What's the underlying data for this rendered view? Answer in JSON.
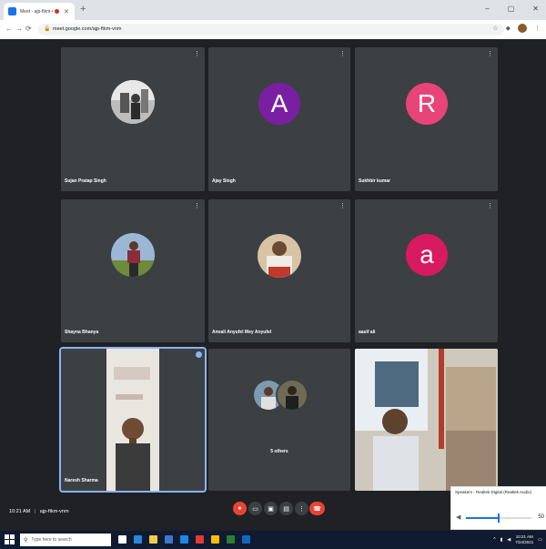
{
  "browser": {
    "tab_title": "Meet - ajp-ftkm-vnm",
    "new_tab_glyph": "+",
    "url": "meet.google.com/ajp-ftkm-vnm",
    "window_controls": [
      "–",
      "▢",
      "✕"
    ]
  },
  "participants": [
    {
      "name": "Sujan Pratap Singh",
      "type": "photo"
    },
    {
      "name": "Ajay Singh",
      "type": "letter",
      "letter": "A",
      "color": "#7b1fa2"
    },
    {
      "name": "Sukhbir kumar",
      "type": "letter",
      "letter": "R",
      "color": "#e8447a"
    },
    {
      "name": "Shayna Bhanya",
      "type": "photo"
    },
    {
      "name": "Anvali Anyufel Mey Anyufel",
      "type": "photo"
    },
    {
      "name": "aasif ali",
      "type": "letter",
      "letter": "a",
      "color": "#d81b60"
    },
    {
      "name": "Naresh Sharma",
      "type": "video"
    },
    {
      "name": "5 others",
      "type": "group"
    },
    {
      "name": "",
      "type": "video"
    }
  ],
  "meeting": {
    "time": "10:21 AM",
    "separator": "|",
    "code": "ajp-ftkm-vnm"
  },
  "speaker_popup": {
    "label": "Speakers - Realtek Digital (Realtek Audio)",
    "volume": 50,
    "volume_label": "50"
  },
  "taskbar": {
    "search_placeholder": "Type here to search",
    "clock_time": "10:21 AM",
    "clock_date": "7/24/2021"
  },
  "colors": {
    "meet_bg": "#202124",
    "tile_bg": "#3c4043",
    "active_border": "#8ab4f8",
    "end_call": "#ea4335"
  }
}
